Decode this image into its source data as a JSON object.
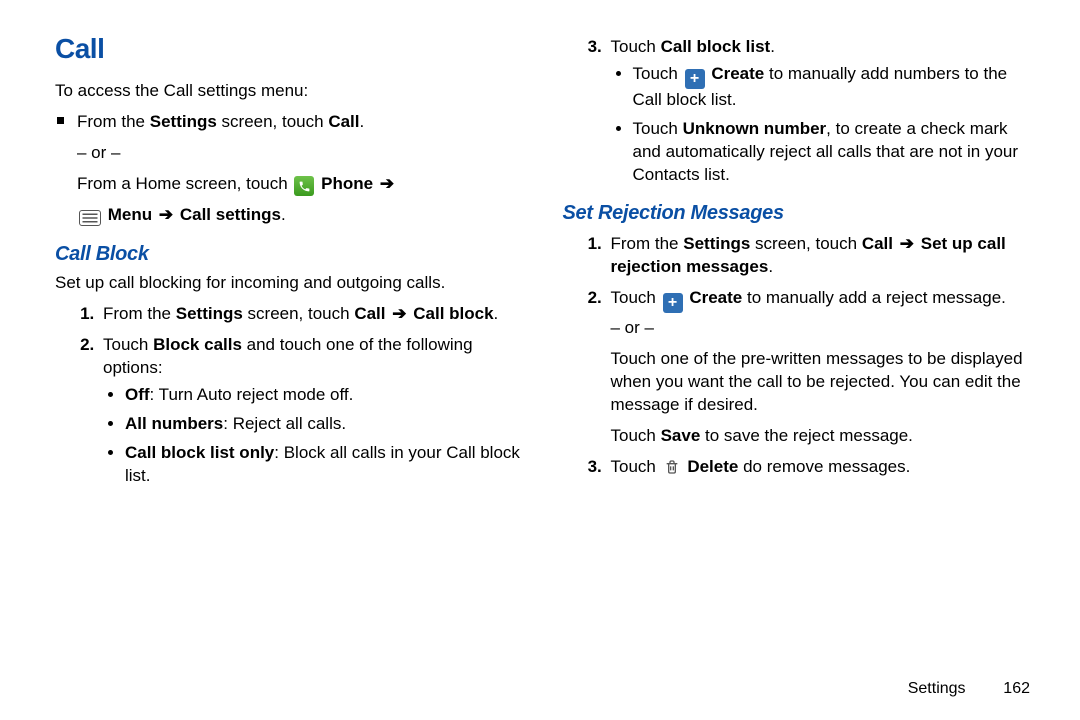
{
  "title": "Call",
  "intro": "To access the Call settings menu:",
  "fromSettingsPrefix": "From the ",
  "settings": "Settings",
  "screenTouch": " screen, touch ",
  "call": "Call",
  "period": ".",
  "or": "– or –",
  "fromHomePrefix": "From a Home screen, touch ",
  "phone": "Phone",
  "arrow": "➔",
  "menu": "Menu",
  "callSettings": "Call settings",
  "callBlockHeading": "Call Block",
  "callBlockIntro": "Set up call blocking for incoming and outgoing calls.",
  "cb1_pre": "From the ",
  "cb1_call": "Call",
  "cb1_callBlock": "Call block",
  "cb2_pre": "Touch ",
  "cb2_blockCalls": "Block calls",
  "cb2_post": " and touch one of the following options:",
  "cb_opt1_b": "Off",
  "cb_opt1_t": ": Turn Auto reject mode off.",
  "cb_opt2_b": "All numbers",
  "cb_opt2_t": ": Reject all calls.",
  "cb_opt3_b": "Call block list only",
  "cb_opt3_t": ": Block all calls in your Call block list.",
  "cb3_pre": "Touch ",
  "cb3_b": "Call block list",
  "cb3_sub1_pre": "Touch ",
  "cb3_sub1_b": "Create",
  "cb3_sub1_post": " to manually add numbers to the Call block list.",
  "cb3_sub2_pre": "Touch ",
  "cb3_sub2_b": "Unknown number",
  "cb3_sub2_post": ", to create a check mark and automatically reject all calls that are not in your Contacts list.",
  "srmHeading": "Set Rejection Messages",
  "srm1_pre": "From the ",
  "srm1_b1": "Call",
  "srm1_b2": "Set up call rejection messages",
  "srm2_pre": "Touch ",
  "srm2_b": "Create",
  "srm2_post": " to manually add a reject message.",
  "srm2_post2": "Touch one of the pre-written messages to be displayed when you want the call to be rejected. You can edit the message if desired.",
  "srm2_save_pre": "Touch ",
  "srm2_save_b": "Save",
  "srm2_save_post": " to save the reject message.",
  "srm3_pre": "Touch ",
  "srm3_b": "Delete",
  "srm3_post": " do remove messages.",
  "footerSection": "Settings",
  "footerPage": "162"
}
